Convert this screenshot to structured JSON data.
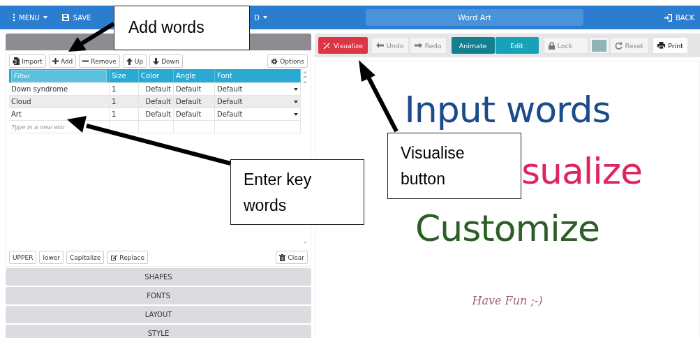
{
  "toolbar": {
    "menus": [
      {
        "label": "MENU",
        "kind": "menu"
      },
      {
        "label": "SAVE",
        "kind": "save"
      },
      {
        "label": "D",
        "kind": "partial"
      }
    ],
    "title": "Word Art",
    "back": "BACK"
  },
  "words_panel": {
    "buttons": [
      {
        "label": "Import"
      },
      {
        "label": "Add"
      },
      {
        "label": "Remove"
      },
      {
        "label": "Up"
      },
      {
        "label": "Down"
      }
    ],
    "options": "Options",
    "columns": [
      {
        "placeholder": "Filter",
        "kind": "filter"
      },
      {
        "label": "Size",
        "kind": "plain"
      },
      {
        "label": "Color",
        "kind": "plain"
      },
      {
        "label": "Angle",
        "kind": "plain"
      },
      {
        "label": "Font",
        "kind": "plain"
      }
    ],
    "rows": [
      {
        "word": "Down syndrome",
        "size": "1",
        "color_setting": "Default",
        "angle": "Default",
        "font": "Default"
      },
      {
        "word": "Cloud",
        "size": "1",
        "color_setting": "Default",
        "angle": "Default",
        "font": "Default"
      },
      {
        "word": "Art",
        "size": "1",
        "color_setting": "Default",
        "angle": "Default",
        "font": "Default"
      }
    ],
    "new_word_placeholder": "Type in a new wor",
    "case_buttons": [
      {
        "label": "UPPER"
      },
      {
        "label": "lower"
      },
      {
        "label": "Capitalize"
      },
      {
        "label": "Replace"
      }
    ],
    "clear": "Clear"
  },
  "sections": [
    "SHAPES",
    "FONTS",
    "LAYOUT",
    "STYLE"
  ],
  "canvas_toolbar": [
    {
      "label": "Visualize",
      "kind": "primary"
    },
    {
      "label": "Undo",
      "kind": "undo"
    },
    {
      "label": "Redo",
      "kind": "redo"
    },
    {
      "label": "Animate",
      "kind": "mode",
      "selected": true
    },
    {
      "label": "Edit",
      "kind": "mode",
      "selected": false
    },
    {
      "label": "Lock",
      "kind": "lock"
    },
    {
      "kind": "swatch",
      "color": "#8fb5b8"
    },
    {
      "label": "Reset",
      "kind": "reset"
    },
    {
      "label": "Print",
      "kind": "print"
    }
  ],
  "canvas_words": [
    {
      "text": "Input words",
      "color": "#1b4b8a",
      "kind": "large"
    },
    {
      "text": "sualize",
      "color": "#e0245e",
      "kind": "large"
    },
    {
      "text": "Customize",
      "color": "#2d5e27",
      "kind": "large"
    },
    {
      "text": "Have Fun ;-)",
      "color": "#a0607e",
      "kind": "script"
    }
  ],
  "callouts": [
    {
      "text": "Add words"
    },
    {
      "text": "Enter key words"
    },
    {
      "text": "Visualise button"
    }
  ]
}
